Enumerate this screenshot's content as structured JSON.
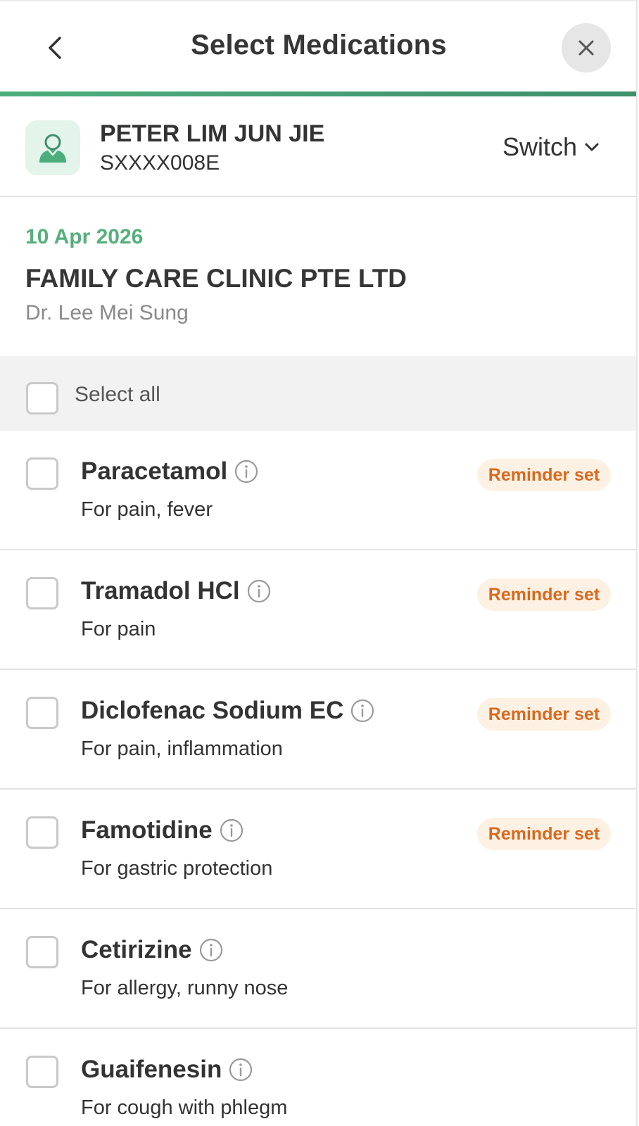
{
  "header": {
    "title": "Select Medications"
  },
  "patient": {
    "name": "PETER LIM JUN JIE",
    "id": "SXXXX008E",
    "switch_label": "Switch"
  },
  "visit": {
    "date": "10 Apr 2026",
    "clinic": "FAMILY CARE CLINIC PTE LTD",
    "doctor": "Dr. Lee Mei Sung"
  },
  "select_all": {
    "label": "Select all",
    "checked": false
  },
  "medications": [
    {
      "name": "Paracetamol",
      "purpose": "For pain, fever",
      "reminder": "Reminder set",
      "checked": false
    },
    {
      "name": "Tramadol HCl",
      "purpose": "For pain",
      "reminder": "Reminder set",
      "checked": false
    },
    {
      "name": "Diclofenac Sodium EC",
      "purpose": "For pain, inflammation",
      "reminder": "Reminder set",
      "checked": false
    },
    {
      "name": "Famotidine",
      "purpose": "For gastric protection",
      "reminder": "Reminder set",
      "checked": false
    },
    {
      "name": "Cetirizine",
      "purpose": "For allergy, runny nose",
      "reminder": "",
      "checked": false
    },
    {
      "name": "Guaifenesin",
      "purpose": "For cough with phlegm",
      "reminder": "",
      "checked": false
    }
  ],
  "icons": {
    "back": "chevron-left-icon",
    "close": "close-icon",
    "avatar": "user-icon",
    "switch": "chevron-down-icon",
    "info": "info-icon"
  },
  "colors": {
    "accent_green": "#55b07c",
    "progress_green": "#3f8f6c",
    "reminder_text": "#d8691f",
    "reminder_bg": "#fdf1e3",
    "avatar_bg": "#e3f4ea"
  }
}
